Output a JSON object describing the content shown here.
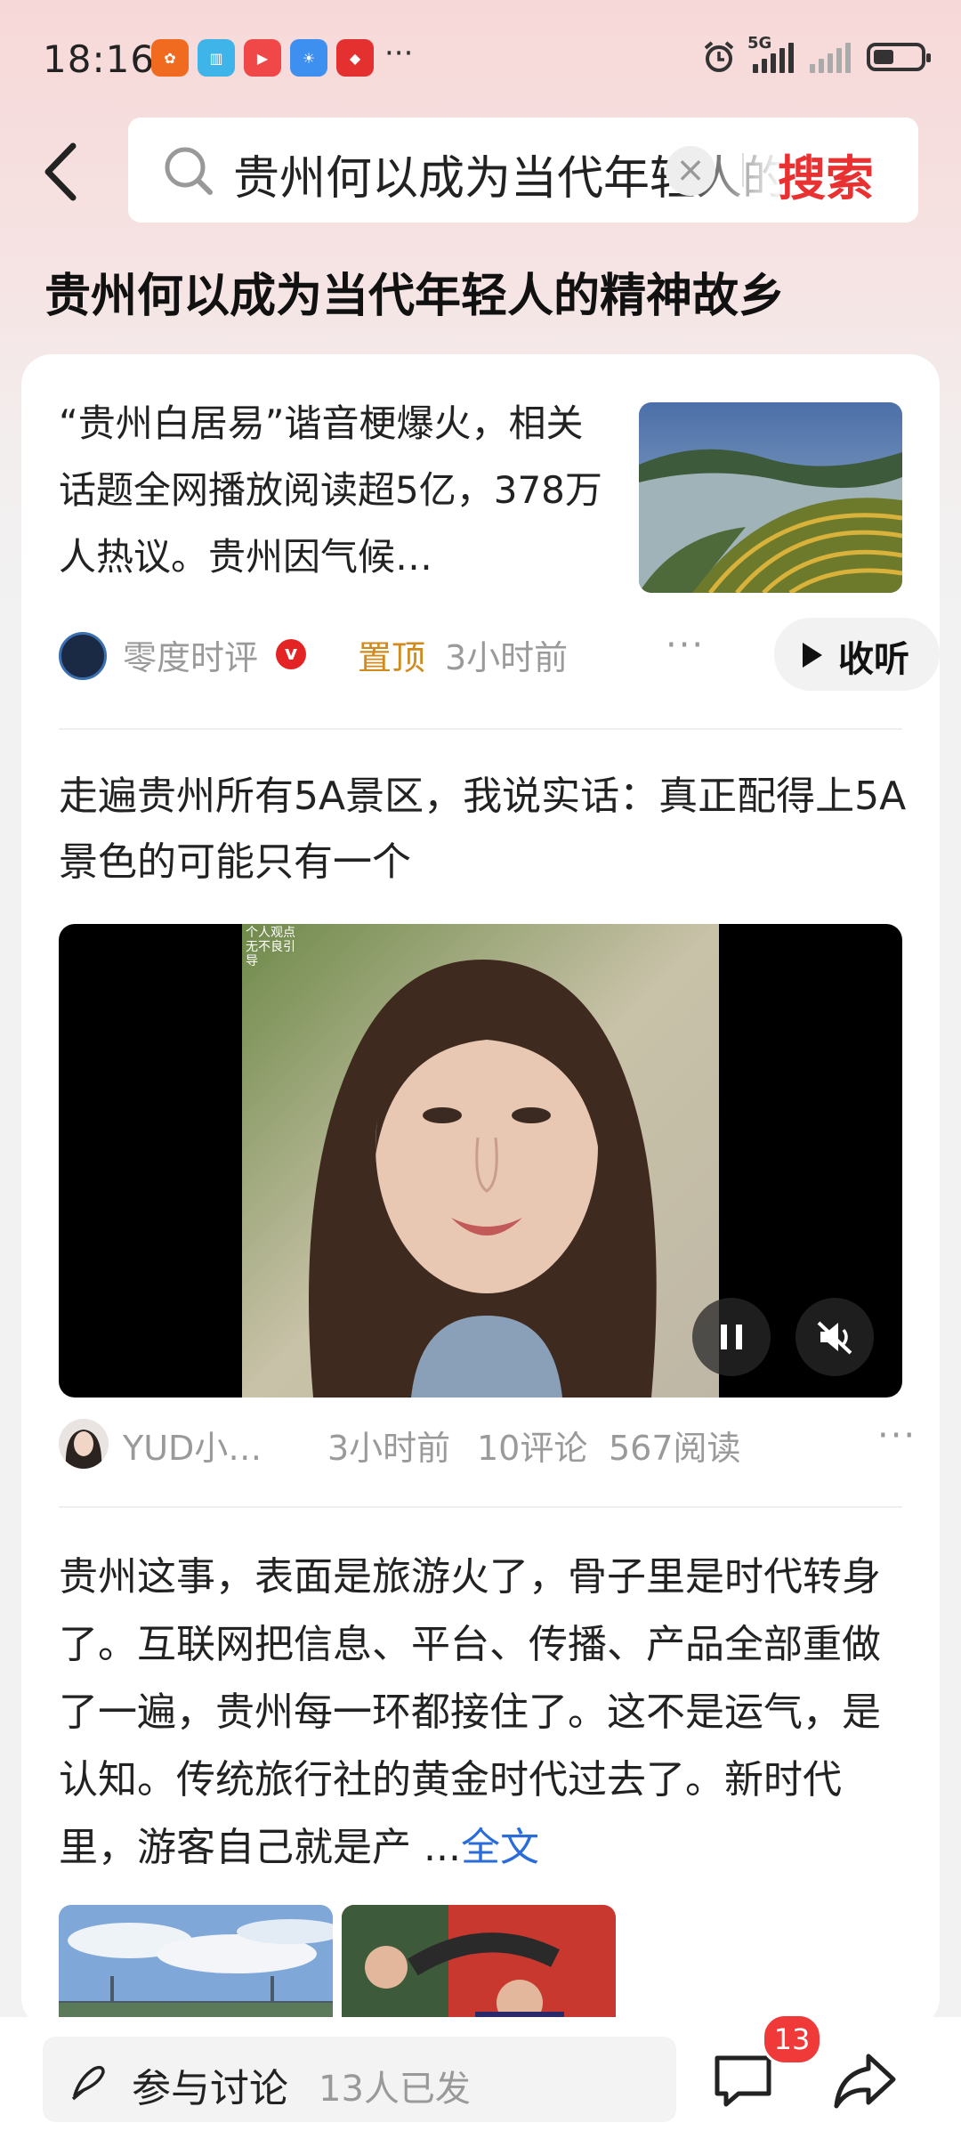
{
  "status_bar": {
    "time": "18:16",
    "more": "···",
    "network": "5G"
  },
  "search": {
    "query": "贵州何以成为当代年轻人的精神故乡",
    "search_button": "搜索"
  },
  "page_title": "贵州何以成为当代年轻人的精神故乡",
  "articles": [
    {
      "text": "“贵州白居易”谐音梗爆火，相关话题全网播放阅读超5亿，378万人热议。贵州因气候…",
      "author": "零度时评",
      "pinned": "置顶",
      "time": "3小时前",
      "listen_button": "收听"
    },
    {
      "title": "走遍贵州所有5A景区，我说实话：真正配得上5A景色的可能只有一个",
      "video_caption": "个人观点 无不良引导",
      "author": "YUD小…",
      "time": "3小时前",
      "comments": "10评论",
      "reads": "567阅读"
    },
    {
      "text": "贵州这事，表面是旅游火了，骨子里是时代转身了。互联网把信息、平台、传播、产品全部重做了一遍，贵州每一环都接住了。这不是运气，是认知。传统旅行社的黄金时代过去了。新时代里，游客自己就是产 ...",
      "full_text_link": "全文"
    }
  ],
  "bottom_bar": {
    "discuss_label": "参与讨论",
    "discuss_count": "13人已发",
    "comment_badge": "13"
  },
  "colors": {
    "accent_red": "#e93131",
    "link_blue": "#2a6cd9",
    "pinned_orange": "#d08a1e"
  }
}
